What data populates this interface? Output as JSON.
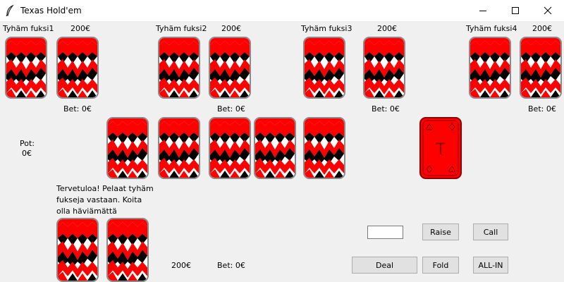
{
  "window": {
    "title": "Texas Hold'em",
    "minimize_icon": "minimize-icon",
    "maximize_icon": "maximize-icon",
    "close_icon": "close-icon"
  },
  "players": [
    {
      "name": "Tyhäm fuksi1",
      "chips": "200€",
      "bet": "Bet: 0€"
    },
    {
      "name": "Tyhäm fuksi2",
      "chips": "200€",
      "bet": "Bet: 0€"
    },
    {
      "name": "Tyhäm fuksi3",
      "chips": "200€",
      "bet": "Bet: 0€"
    },
    {
      "name": "Tyhäm fuksi4",
      "chips": "200€",
      "bet": "Bet: 0€"
    }
  ],
  "pot": {
    "label": "Pot:",
    "value": "0€"
  },
  "deck": {
    "letter": "T"
  },
  "message": "Tervetuloa! Pelaat tyhäm fukseja vastaan. Koita olla häviämättä",
  "user": {
    "chips": "200€",
    "bet": "Bet: 0€"
  },
  "controls": {
    "raise_value": "",
    "raise": "Raise",
    "call": "Call",
    "deal": "Deal",
    "fold": "Fold",
    "allin": "ALL-IN"
  },
  "colors": {
    "card_red": "#ff0000",
    "card_black": "#000000",
    "card_white": "#ffffff",
    "deck_red": "#ff0000"
  }
}
